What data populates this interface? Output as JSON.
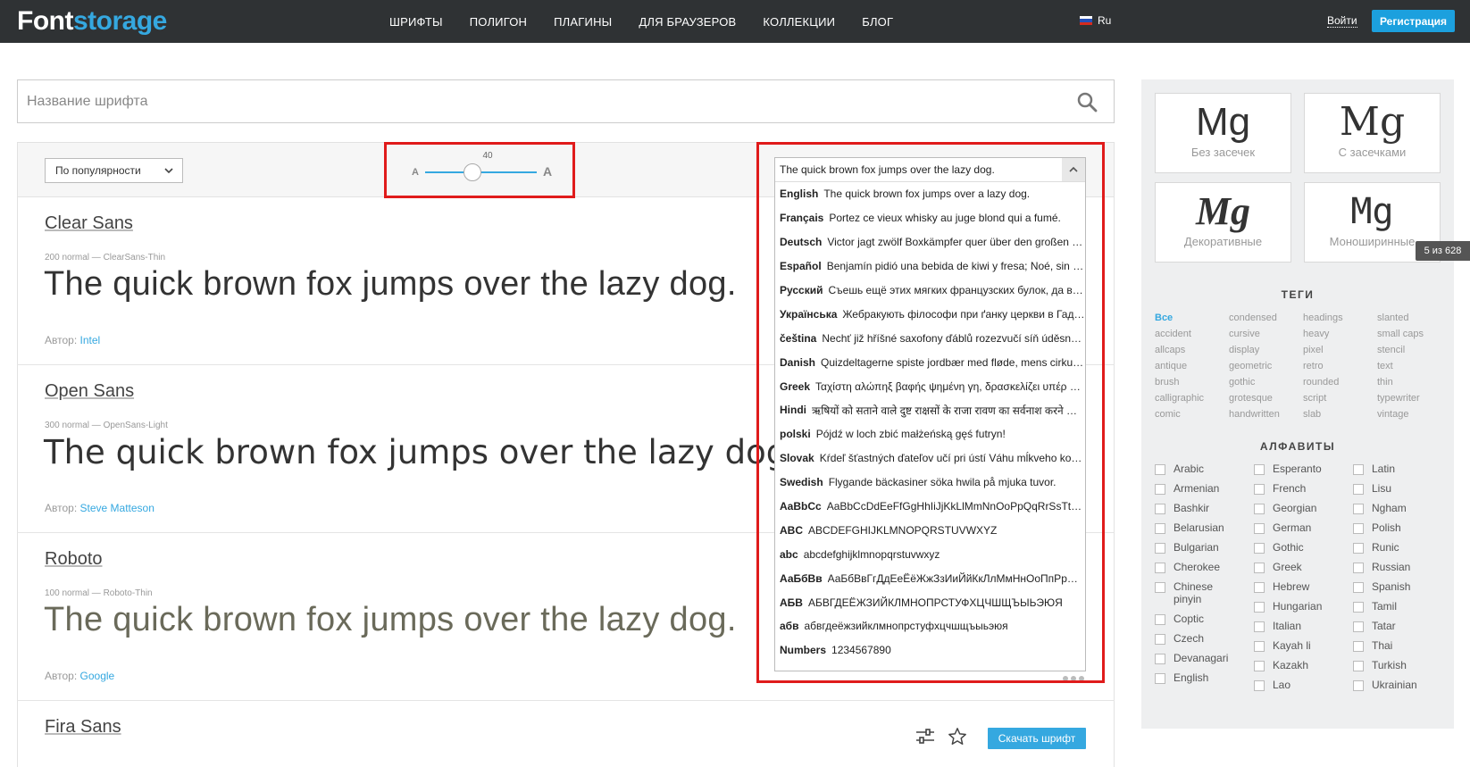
{
  "header": {
    "logo_part1": "Font",
    "logo_part2": "storage",
    "nav": [
      "ШРИФТЫ",
      "ПОЛИГОН",
      "ПЛАГИНЫ",
      "ДЛЯ БРАУЗЕРОВ",
      "КОЛЛЕКЦИИ",
      "БЛОГ"
    ],
    "language": "Ru",
    "login": "Войти",
    "register": "Регистрация"
  },
  "search": {
    "placeholder": "Название шрифта"
  },
  "toolbar": {
    "sort": "По популярности",
    "size_value": "40",
    "size_small_label": "A",
    "size_big_label": "A",
    "size_fraction": 0.33
  },
  "fonts": [
    {
      "name": "Clear Sans",
      "meta": "200 normal — ClearSans-Thin",
      "sample": "The quick brown fox jumps over the lazy dog.",
      "author_label": "Автор:",
      "author": "Intel"
    },
    {
      "name": "Open Sans",
      "meta": "300 normal — OpenSans-Light",
      "sample": "The quick brown fox jumps over the lazy dog.",
      "author_label": "Автор:",
      "author": "Steve Matteson"
    },
    {
      "name": "Roboto",
      "meta": "100 normal — Roboto-Thin",
      "sample": "The quick brown fox jumps over the lazy dog.",
      "author_label": "Автор:",
      "author": "Google"
    },
    {
      "name": "Fira Sans"
    }
  ],
  "download_button": "Скачать шрифт",
  "sample_dropdown": {
    "selected": "The quick brown fox jumps over the lazy dog.",
    "options": [
      {
        "lang": "English",
        "text": "The quick brown fox jumps over a lazy dog."
      },
      {
        "lang": "Français",
        "text": "Portez ce vieux whisky au juge blond qui a fumé."
      },
      {
        "lang": "Deutsch",
        "text": "Victor jagt zwölf Boxkämpfer quer über den großen Sylter Deich."
      },
      {
        "lang": "Español",
        "text": "Benjamín pidió una bebida de kiwi y fresa; Noé, sin vergüenza, la más exquisita champaña del menú."
      },
      {
        "lang": "Русский",
        "text": "Съешь ещё этих мягких французских булок, да выпей же чаю."
      },
      {
        "lang": "Українська",
        "text": "Жебракують філософи при ґанку церкви в Гадячі, ще й шатро їхнє п'яне знаємо."
      },
      {
        "lang": "čeština",
        "text": "Nechť již hříšné saxofony ďáblů rozezvučí síň úděsnými tóny waltzu, tanga a quickstepu."
      },
      {
        "lang": "Danish",
        "text": "Quizdeltagerne spiste jordbær med fløde, mens cirkusklovnen Wolther spillede på xylofon."
      },
      {
        "lang": "Greek",
        "text": "Ταχίστη αλώπηξ βαφής ψημένη γη, δρασκελίζει υπέρ νωθρού κυνός"
      },
      {
        "lang": "Hindi",
        "text": "ऋषियों को सताने वाले दुष्ट राक्षसों के राजा रावण का सर्वनाश करने वाले विष्णुवतार भगवान श्रीराम"
      },
      {
        "lang": "polski",
        "text": "Pójdź w loch zbić małżeńską gęś futryn!"
      },
      {
        "lang": "Slovak",
        "text": "Kŕdeľ šťastných ďateľov učí pri ústí Váhu mĺkveho koňa obhrýzať kôru a žrať čerstvé mäso."
      },
      {
        "lang": "Swedish",
        "text": "Flygande bäckasiner söka hwila på mjuka tuvor."
      },
      {
        "lang": "AaBbCc",
        "text": "AaBbCcDdEeFfGgHhIiJjKkLlMmNnOoPpQqRrSsTtUuVvWwXxYyZz"
      },
      {
        "lang": "ABC",
        "text": "ABCDEFGHIJKLMNOPQRSTUVWXYZ"
      },
      {
        "lang": "abc",
        "text": "abcdefghijklmnopqrstuvwxyz"
      },
      {
        "lang": "АаБбВв",
        "text": "АаБбВвГгДдЕеЁёЖжЗзИиЙйКкЛлМмНнОоПпРрСсТтУуФфХхЦцЧчШшЩщЪъЫыЬьЭэЮюЯя"
      },
      {
        "lang": "АБВ",
        "text": "АБВГДЕЁЖЗИЙКЛМНОПРСТУФХЦЧШЩЪЫЬЭЮЯ"
      },
      {
        "lang": "абв",
        "text": "абвгдеёжзийклмнопрстуфхцчшщъыьэюя"
      },
      {
        "lang": "Numbers",
        "text": "1234567890"
      }
    ]
  },
  "sidebar": {
    "categories": [
      {
        "glyph": "Mg",
        "label": "Без засечек"
      },
      {
        "glyph": "Mg",
        "label": "С засечками"
      },
      {
        "glyph": "Mg",
        "label": "Декоративные"
      },
      {
        "glyph": "Mg",
        "label": "Моноширинные"
      }
    ],
    "count_badge": "5 из 628",
    "tags_title": "ТЕГИ",
    "tags": [
      "Все",
      "condensed",
      "headings",
      "slanted",
      "accident",
      "cursive",
      "heavy",
      "small caps",
      "allcaps",
      "display",
      "pixel",
      "stencil",
      "antique",
      "geometric",
      "retro",
      "text",
      "brush",
      "gothic",
      "rounded",
      "thin",
      "calligraphic",
      "grotesque",
      "script",
      "typewriter",
      "comic",
      "handwritten",
      "slab",
      "vintage"
    ],
    "alphabets_title": "АЛФАВИТЫ",
    "alphabets": [
      [
        "Arabic",
        "Armenian",
        "Bashkir",
        "Belarusian",
        "Bulgarian",
        "Cherokee",
        "Chinese pinyin",
        "Coptic",
        "Czech",
        "Devanagari",
        "English"
      ],
      [
        "Esperanto",
        "French",
        "Georgian",
        "German",
        "Gothic",
        "Greek",
        "Hebrew",
        "Hungarian",
        "Italian",
        "Kayah li",
        "Kazakh",
        "Lao"
      ],
      [
        "Latin",
        "Lisu",
        "Ngham",
        "Polish",
        "Runic",
        "Russian",
        "Spanish",
        "Tamil",
        "Tatar",
        "Thai",
        "Turkish",
        "Ukrainian"
      ]
    ]
  }
}
